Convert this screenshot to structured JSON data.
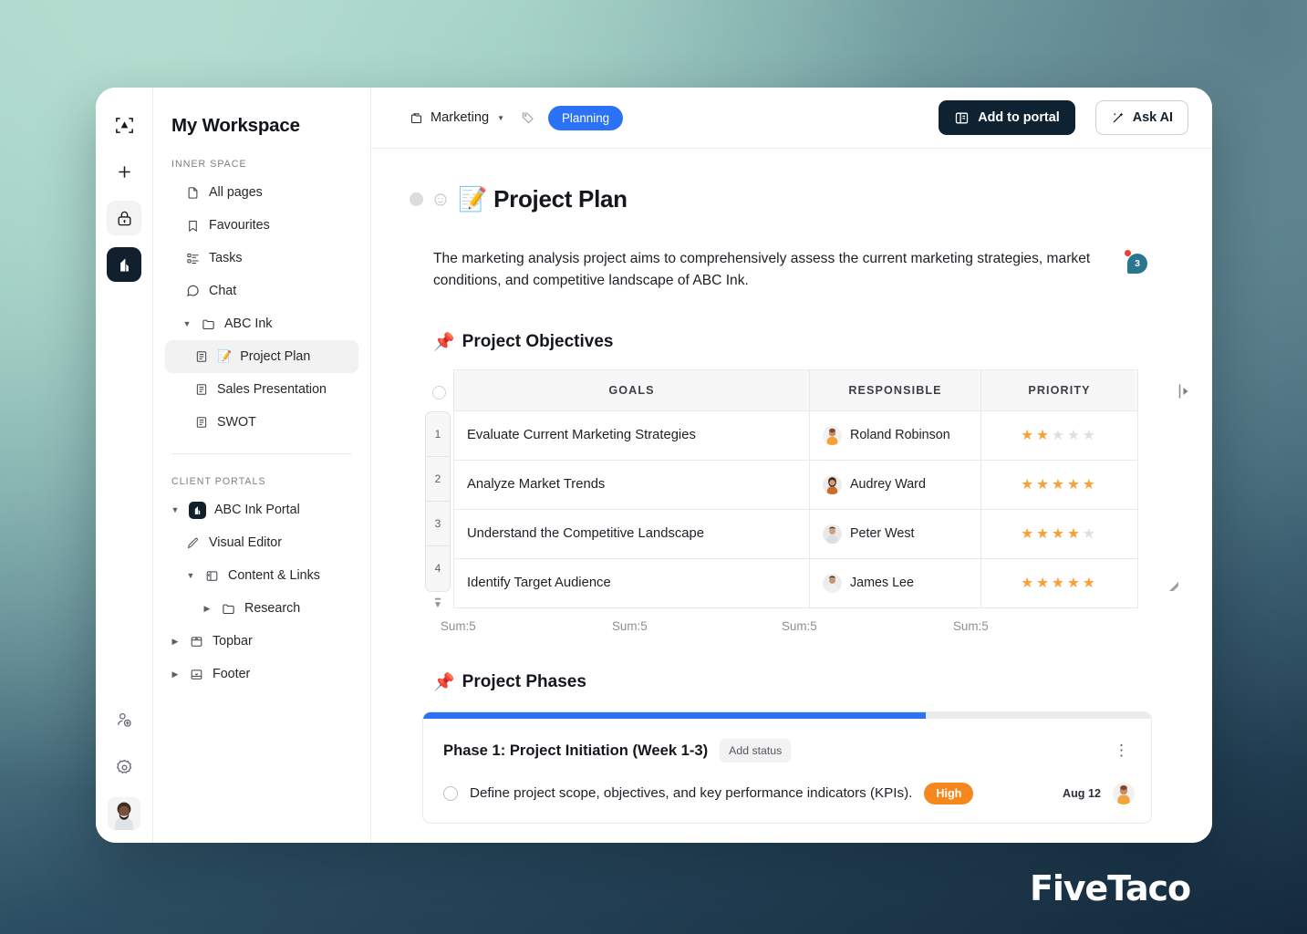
{
  "brand": {
    "name": "FiveTaco"
  },
  "rail": {
    "items": [
      {
        "name": "logo-icon",
        "label": "Logo"
      },
      {
        "name": "add-icon",
        "label": "Add"
      },
      {
        "name": "lock-icon",
        "label": "Private"
      },
      {
        "name": "portal-icon",
        "label": "Portal"
      }
    ],
    "bottom": [
      {
        "name": "invite-user-icon",
        "label": "Invite"
      },
      {
        "name": "settings-gear-icon",
        "label": "Settings"
      },
      {
        "name": "user-avatar",
        "label": "Account"
      }
    ]
  },
  "sidebar": {
    "workspace_title": "My Workspace",
    "section_inner": "INNER SPACE",
    "section_portals": "CLIENT PORTALS",
    "inner_items": [
      {
        "label": "All pages",
        "icon": "page-icon",
        "indent": 1,
        "caret": "",
        "selected": false
      },
      {
        "label": "Favourites",
        "icon": "bookmark-icon",
        "indent": 1,
        "caret": "",
        "selected": false
      },
      {
        "label": "Tasks",
        "icon": "tasks-icon",
        "indent": 1,
        "caret": "",
        "selected": false
      },
      {
        "label": "Chat",
        "icon": "chat-icon",
        "indent": 1,
        "caret": "",
        "selected": false
      },
      {
        "label": "ABC Ink",
        "icon": "folder-icon",
        "indent": 1,
        "caret": "down",
        "selected": false
      },
      {
        "label": "Project Plan",
        "emoji": "📝",
        "icon": "doc-icon",
        "indent": 2,
        "caret": "",
        "selected": true
      },
      {
        "label": "Sales Presentation",
        "icon": "doc-icon",
        "indent": 2,
        "caret": "",
        "selected": false
      },
      {
        "label": "SWOT",
        "icon": "doc-icon",
        "indent": 2,
        "caret": "",
        "selected": false
      }
    ],
    "portal_items": [
      {
        "label": "ABC Ink Portal",
        "icon": "portal-badge-icon",
        "indent": 0,
        "caret": "down"
      },
      {
        "label": "Visual Editor",
        "icon": "pencil-icon",
        "indent": 1,
        "caret": ""
      },
      {
        "label": "Content & Links",
        "icon": "panel-icon",
        "indent": 1,
        "caret": "down"
      },
      {
        "label": "Research",
        "icon": "folder-icon",
        "indent": 2,
        "caret": "right"
      },
      {
        "label": "Topbar",
        "icon": "topbar-icon",
        "indent": 0,
        "caret": "right"
      },
      {
        "label": "Footer",
        "icon": "footer-icon",
        "indent": 0,
        "caret": "right"
      }
    ]
  },
  "topbar": {
    "breadcrumb": "Marketing",
    "tag": "Planning",
    "add_to_portal": "Add to portal",
    "ask_ai": "Ask AI"
  },
  "doc": {
    "title": "Project Plan",
    "title_emoji": "📝",
    "description": "The marketing analysis project aims to comprehensively assess the current marketing strategies, market conditions, and competitive landscape of ABC Ink.",
    "comment_count": "3"
  },
  "objectives": {
    "heading": "Project Objectives",
    "heading_emoji": "📌",
    "columns": [
      "GOALS",
      "RESPONSIBLE",
      "PRIORITY"
    ],
    "rows": [
      {
        "n": "1",
        "goal": "Evaluate Current Marketing Strategies",
        "responsible": "Roland Robinson",
        "priority": 2,
        "priority_max": 5
      },
      {
        "n": "2",
        "goal": "Analyze Market Trends",
        "responsible": "Audrey Ward",
        "priority": 5,
        "priority_max": 5
      },
      {
        "n": "3",
        "goal": "Understand the Competitive Landscape",
        "responsible": "Peter West",
        "priority": 4,
        "priority_max": 5
      },
      {
        "n": "4",
        "goal": "Identify Target Audience",
        "responsible": "James Lee",
        "priority": 5,
        "priority_max": 5
      }
    ],
    "sums": [
      "Sum:5",
      "Sum:5",
      "Sum:5",
      "Sum:5"
    ]
  },
  "phases": {
    "heading": "Project Phases",
    "heading_emoji": "📌",
    "card": {
      "progress_percent": 69,
      "title": "Phase 1: Project Initiation (Week 1-3)",
      "status_label": "Add status",
      "task": {
        "text": "Define project scope, objectives, and key performance indicators (KPIs).",
        "priority": "High",
        "date": "Aug 12"
      }
    }
  },
  "colors": {
    "accent_blue": "#2b72f6",
    "dark_navy": "#0e2231",
    "star_on": "#f8a033",
    "star_off": "#dddfe1",
    "badge_orange": "#f6871f",
    "comment_teal": "#2a7590"
  }
}
